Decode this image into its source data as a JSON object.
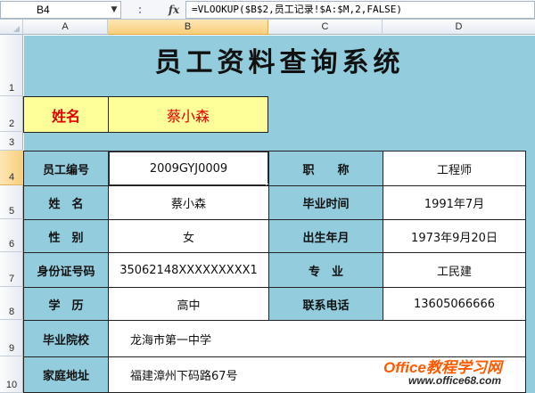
{
  "formula_bar": {
    "name_box": "B4",
    "fx_label": "fx",
    "formula": "=VLOOKUP($B$2,员工记录!$A:$M,2,FALSE)"
  },
  "columns": [
    "A",
    "B",
    "C",
    "D"
  ],
  "rows": [
    "1",
    "2",
    "3",
    "4",
    "5",
    "6",
    "7",
    "8",
    "9",
    "10"
  ],
  "title": "员工资料查询系统",
  "search": {
    "label": "姓名",
    "value": "蔡小森"
  },
  "fields": {
    "emp_no": {
      "label": "员工编号",
      "value": "2009GYJ0009"
    },
    "title_pos": {
      "label": "职　　称",
      "value": "工程师"
    },
    "name": {
      "label": "姓　名",
      "value": "蔡小森"
    },
    "grad_time": {
      "label": "毕业时间",
      "value": "1991年7月"
    },
    "gender": {
      "label": "性　别",
      "value": "女"
    },
    "birth": {
      "label": "出生年月",
      "value": "1973年9月20日"
    },
    "id_no": {
      "label": "身份证号码",
      "value": "35062148XXXXXXXXX1"
    },
    "major": {
      "label": "专　业",
      "value": "工民建"
    },
    "education": {
      "label": "学　历",
      "value": "高中"
    },
    "phone": {
      "label": "联系电话",
      "value": "13605066666"
    },
    "school": {
      "label": "毕业院校",
      "value": "龙海市第一中学"
    },
    "address": {
      "label": "家庭地址",
      "value": "福建漳州下码路67号"
    }
  },
  "watermark": {
    "line1": "Office教程学习网",
    "line2": "www.office68.com"
  },
  "colors": {
    "sheet_bg": "#93cddd",
    "header_highlight": "#ffff99",
    "name_red": "#e00000"
  }
}
